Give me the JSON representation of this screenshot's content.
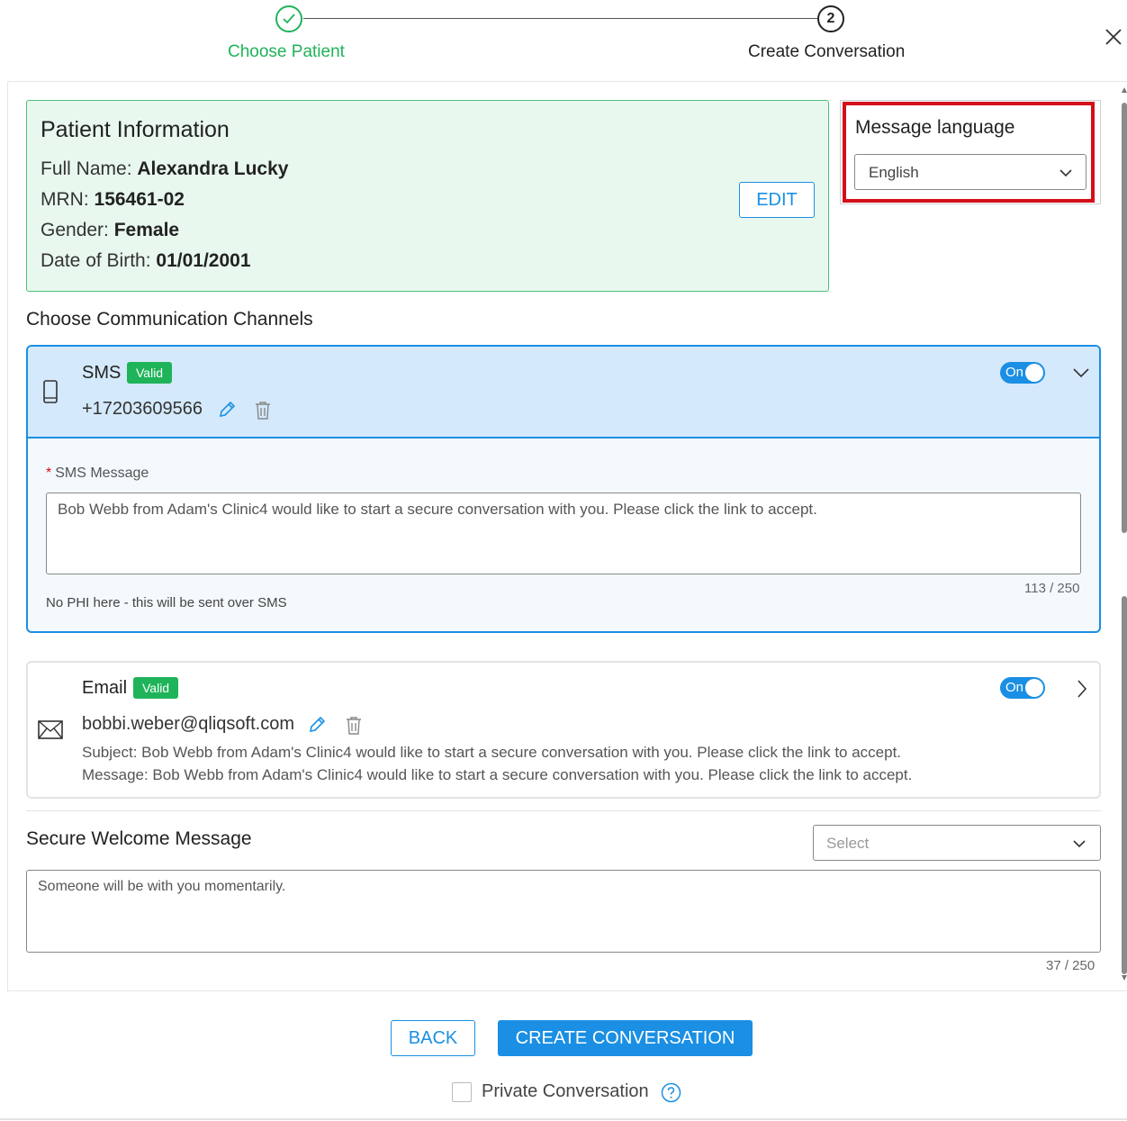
{
  "stepper": {
    "step1_label": "Choose Patient",
    "step2_number": "2",
    "step2_label": "Create Conversation"
  },
  "patient": {
    "title": "Patient Information",
    "full_name_label": "Full Name:",
    "full_name": "Alexandra Lucky",
    "mrn_label": "MRN:",
    "mrn": "156461-02",
    "gender_label": "Gender:",
    "gender": "Female",
    "dob_label": "Date of Birth:",
    "dob": "01/01/2001",
    "edit_label": "EDIT"
  },
  "language": {
    "title": "Message language",
    "selected": "English"
  },
  "channels": {
    "title": "Choose Communication Channels",
    "sms": {
      "name": "SMS",
      "badge": "Valid",
      "contact": "+17203609566",
      "toggle": "On",
      "message_label": "SMS Message",
      "message": "Bob Webb from Adam's Clinic4 would like to start a secure conversation with you. Please click the link to accept.",
      "counter": "113 / 250",
      "hint": "No PHI here - this will be sent over SMS"
    },
    "email": {
      "name": "Email",
      "badge": "Valid",
      "contact": "bobbi.weber@qliqsoft.com",
      "toggle": "On",
      "subject": "Subject: Bob Webb from Adam's Clinic4 would like to start a secure conversation with you. Please click the link to accept.",
      "message": "Message: Bob Webb from Adam's Clinic4 would like to start a secure conversation with you. Please click the link to accept."
    }
  },
  "welcome": {
    "title": "Secure Welcome Message",
    "select_placeholder": "Select",
    "message": "Someone will be with you momentarily.",
    "counter": "37 / 250"
  },
  "footer": {
    "back_label": "BACK",
    "create_label": "CREATE CONVERSATION",
    "private_label": "Private Conversation"
  },
  "colors": {
    "accent": "#1a8fe3",
    "success": "#1fb35a",
    "highlight": "#d40f1a"
  }
}
